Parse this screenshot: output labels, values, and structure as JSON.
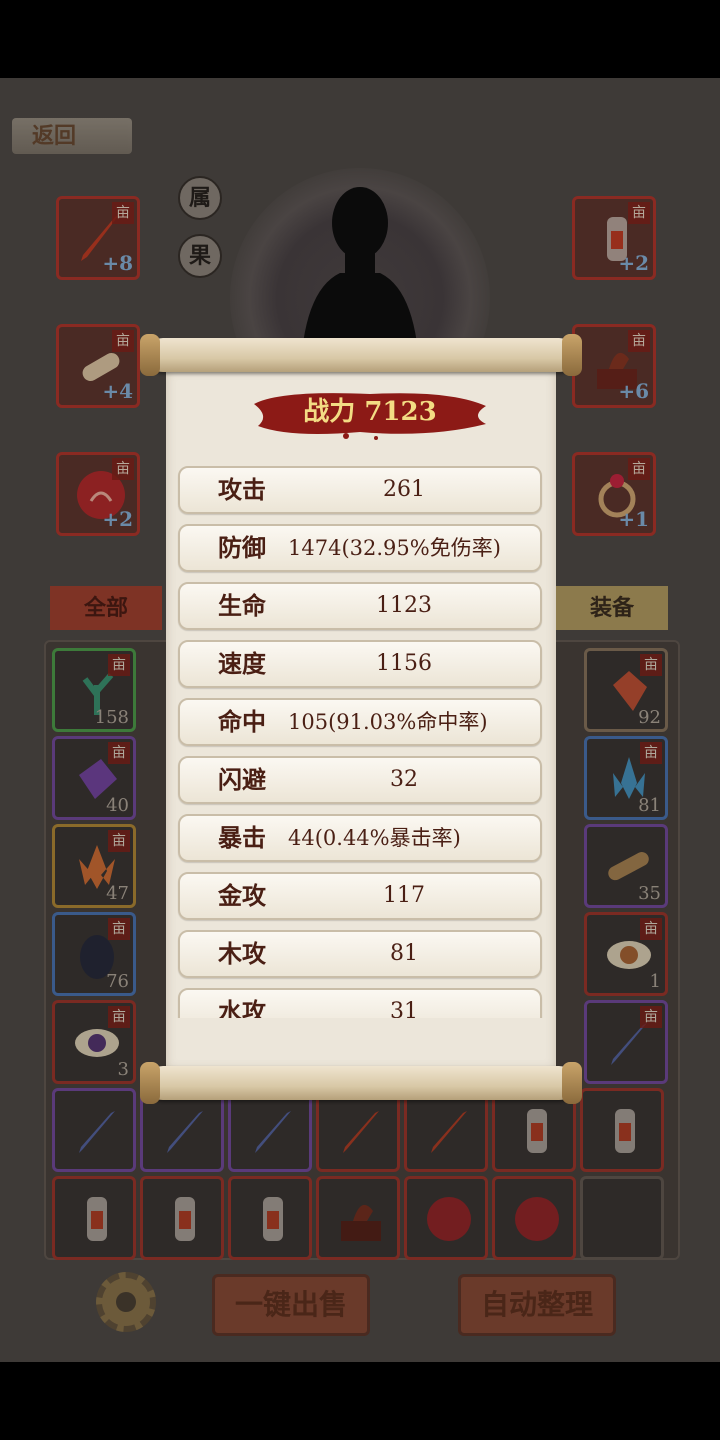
{
  "header": {
    "back_label": "返回"
  },
  "side_buttons": {
    "attr_label": "属",
    "fruit_label": "果"
  },
  "equip_left": [
    {
      "icon": "red-sword-icon",
      "tag": "亩",
      "plus": "+8"
    },
    {
      "icon": "scroll-icon",
      "tag": "亩",
      "plus": "+4"
    },
    {
      "icon": "red-orb-icon",
      "tag": "亩",
      "plus": "+2"
    }
  ],
  "equip_right": [
    {
      "icon": "armor-warrior-icon",
      "tag": "亩",
      "plus": "+2"
    },
    {
      "icon": "dragon-altar-icon",
      "tag": "亩",
      "plus": "+6"
    },
    {
      "icon": "ring-icon",
      "tag": "亩",
      "plus": "+1"
    }
  ],
  "tabs": {
    "all_label": "全部",
    "equip_label": "装备"
  },
  "inventory_visible": [
    {
      "icon": "coral-icon",
      "count": "158"
    },
    {
      "icon": "red-gem-icon",
      "count": "92"
    },
    {
      "icon": "purple-gem-icon",
      "count": "40"
    },
    {
      "icon": "blue-crystal-icon",
      "count": "81"
    },
    {
      "icon": "flame-crystal-icon",
      "count": "47"
    },
    {
      "icon": "rope-scroll-icon",
      "count": "35"
    },
    {
      "icon": "dark-egg-icon",
      "count": "76"
    },
    {
      "icon": "pearl-icon",
      "count": "1"
    },
    {
      "icon": "eye-orb-icon",
      "count": "3"
    },
    {
      "icon": "blue-sword-icon",
      "count": ""
    }
  ],
  "bottom": {
    "sell_label": "一键出售",
    "sort_label": "自动整理"
  },
  "popup": {
    "power_label": "战力 7123",
    "stats": [
      {
        "label": "攻击",
        "value": "261"
      },
      {
        "label": "防御",
        "value": "1474(32.95%免伤率)"
      },
      {
        "label": "生命",
        "value": "1123"
      },
      {
        "label": "速度",
        "value": "1156"
      },
      {
        "label": "命中",
        "value": "105(91.03%命中率)"
      },
      {
        "label": "闪避",
        "value": "32"
      },
      {
        "label": "暴击",
        "value": "44(0.44%暴击率)"
      },
      {
        "label": "金攻",
        "value": "117"
      },
      {
        "label": "木攻",
        "value": "81"
      },
      {
        "label": "水攻",
        "value": "31"
      }
    ]
  }
}
